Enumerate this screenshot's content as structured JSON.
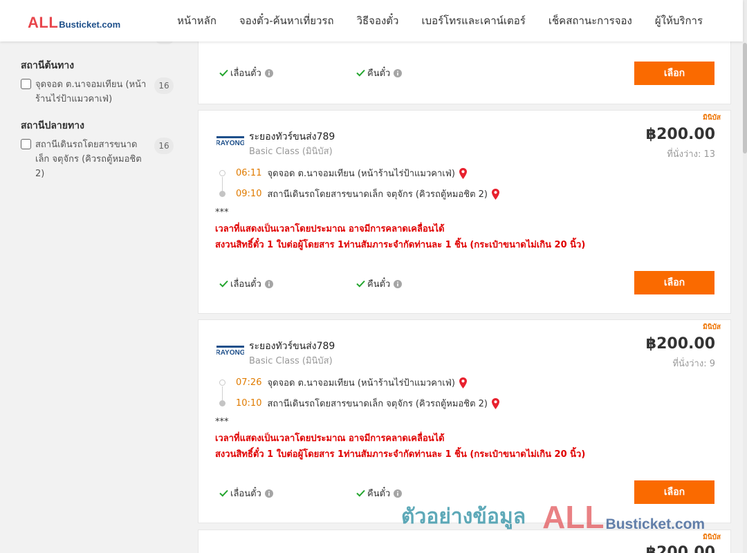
{
  "header": {
    "logo_all": "ALL",
    "logo_rest": "Busticket.com",
    "nav": [
      "หน้าหลัก",
      "จองตั๋ว-ค้นหาเที่ยวรถ",
      "วิธีจองตั๋ว",
      "เบอร์โทรและเคาน์เตอร์",
      "เช็คสถานะการจอง",
      "ผู้ให้บริการ"
    ]
  },
  "sidebar": {
    "origin": {
      "title": "สถานีต้นทาง",
      "options": [
        {
          "label": "จุดจอด ต.นาจอมเทียน (หน้าร้านไร่ป้าแมวคาเฟ่)",
          "count": "16",
          "checked": false
        }
      ]
    },
    "destination": {
      "title": "สถานีปลายทาง",
      "options": [
        {
          "label": "สถานีเดินรถโดยสารขนาดเล็ก จตุจักร (คิวรถตู้หมอชิต 2)",
          "count": "16",
          "checked": false
        }
      ]
    }
  },
  "policies": {
    "reschedule": "เลื่อนตั๋ว",
    "refund": "คืนตั๋ว"
  },
  "select_label": "เลือก",
  "cards": [
    {
      "operator": "ระยองทัวร์ขนส่ง789",
      "class": "Basic Class (มินิบัส)",
      "badge": "มินิบัส",
      "price": "฿200.00",
      "seats": "ที่นั่งว่าง: 13",
      "departure": {
        "time": "06:11",
        "place": "จุดจอด ต.นาจอมเทียน (หน้าร้านไร่ป้าแมวคาเฟ่)"
      },
      "arrival": {
        "time": "09:10",
        "place": "สถานีเดินรถโดยสารขนาดเล็ก จตุจักร (คิวรถตู้หมอชิต 2)"
      },
      "note_mark": "***",
      "notices": [
        "เวลาที่แสดงเป็นเวลาโดยประมาณ อาจมีการคลาดเคลื่อนได้",
        "สงวนสิทธิ์ตั๋ว 1 ใบต่อผู้โดยสาร 1ท่านสัมภาระจำกัดท่านละ 1 ชิ้น (กระเป๋าขนาดไม่เกิน 20 นิ้ว)"
      ]
    },
    {
      "operator": "ระยองทัวร์ขนส่ง789",
      "class": "Basic Class (มินิบัส)",
      "badge": "มินิบัส",
      "price": "฿200.00",
      "seats": "ที่นั่งว่าง: 9",
      "departure": {
        "time": "07:26",
        "place": "จุดจอด ต.นาจอมเทียน (หน้าร้านไร่ป้าแมวคาเฟ่)"
      },
      "arrival": {
        "time": "10:10",
        "place": "สถานีเดินรถโดยสารขนาดเล็ก จตุจักร (คิวรถตู้หมอชิต 2)"
      },
      "note_mark": "***",
      "notices": [
        "เวลาที่แสดงเป็นเวลาโดยประมาณ อาจมีการคลาดเคลื่อนได้",
        "สงวนสิทธิ์ตั๋ว 1 ใบต่อผู้โดยสาร 1ท่านสัมภาระจำกัดท่านละ 1 ชิ้น (กระเป๋าขนาดไม่เกิน 20 นิ้ว)"
      ]
    }
  ],
  "partial_card": {
    "badge": "มินิบัส",
    "price": "฿200.00"
  },
  "watermark": {
    "thai": "ตัวอย่างข้อมูล",
    "all": "ALL",
    "rest": "Busticket.com"
  },
  "operator_logo_text": "RAYONG",
  "colors": {
    "accent": "#fa6a00",
    "time": "#e07b00",
    "notice": "#e00000",
    "check": "#22a52d",
    "pin": "#e8212e"
  },
  "icons": {
    "check": "check-icon",
    "info": "info-icon",
    "pin": "map-pin-icon"
  }
}
